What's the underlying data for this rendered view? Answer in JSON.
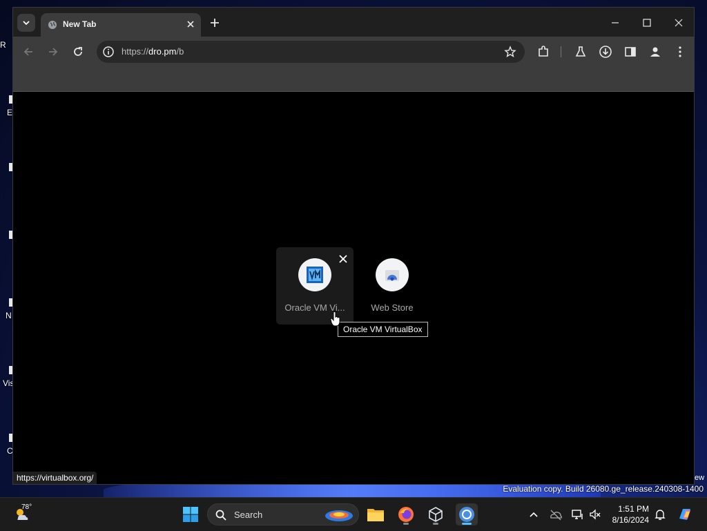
{
  "desktop": {
    "icon_labels": [
      "R",
      "E",
      "N",
      "Vis",
      "C"
    ],
    "evaluation_text": "Evaluation copy. Build 26080.ge_release.240308-1400",
    "partial_text": "ew"
  },
  "browser": {
    "tab": {
      "title": "New Tab",
      "favicon": "globe-icon"
    },
    "address": {
      "scheme": "https://",
      "host": "dro.pm",
      "path": "/b"
    },
    "window_controls": [
      "minimize",
      "maximize",
      "close"
    ]
  },
  "shortcuts": [
    {
      "label": "Oracle VM Vi...",
      "icon": "virtualbox-icon",
      "hovered": true
    },
    {
      "label": "Web Store",
      "icon": "webstore-icon",
      "hovered": false
    }
  ],
  "tooltip": "Oracle VM VirtualBox",
  "status_url": "https://virtualbox.org/",
  "taskbar": {
    "weather_temp": "78°",
    "search_label": "Search",
    "time": "1:51 PM",
    "date": "8/16/2024",
    "apps": [
      "start",
      "file-explorer",
      "firefox",
      "virtualbox",
      "chrome"
    ],
    "accent": "#4cc2ff"
  }
}
